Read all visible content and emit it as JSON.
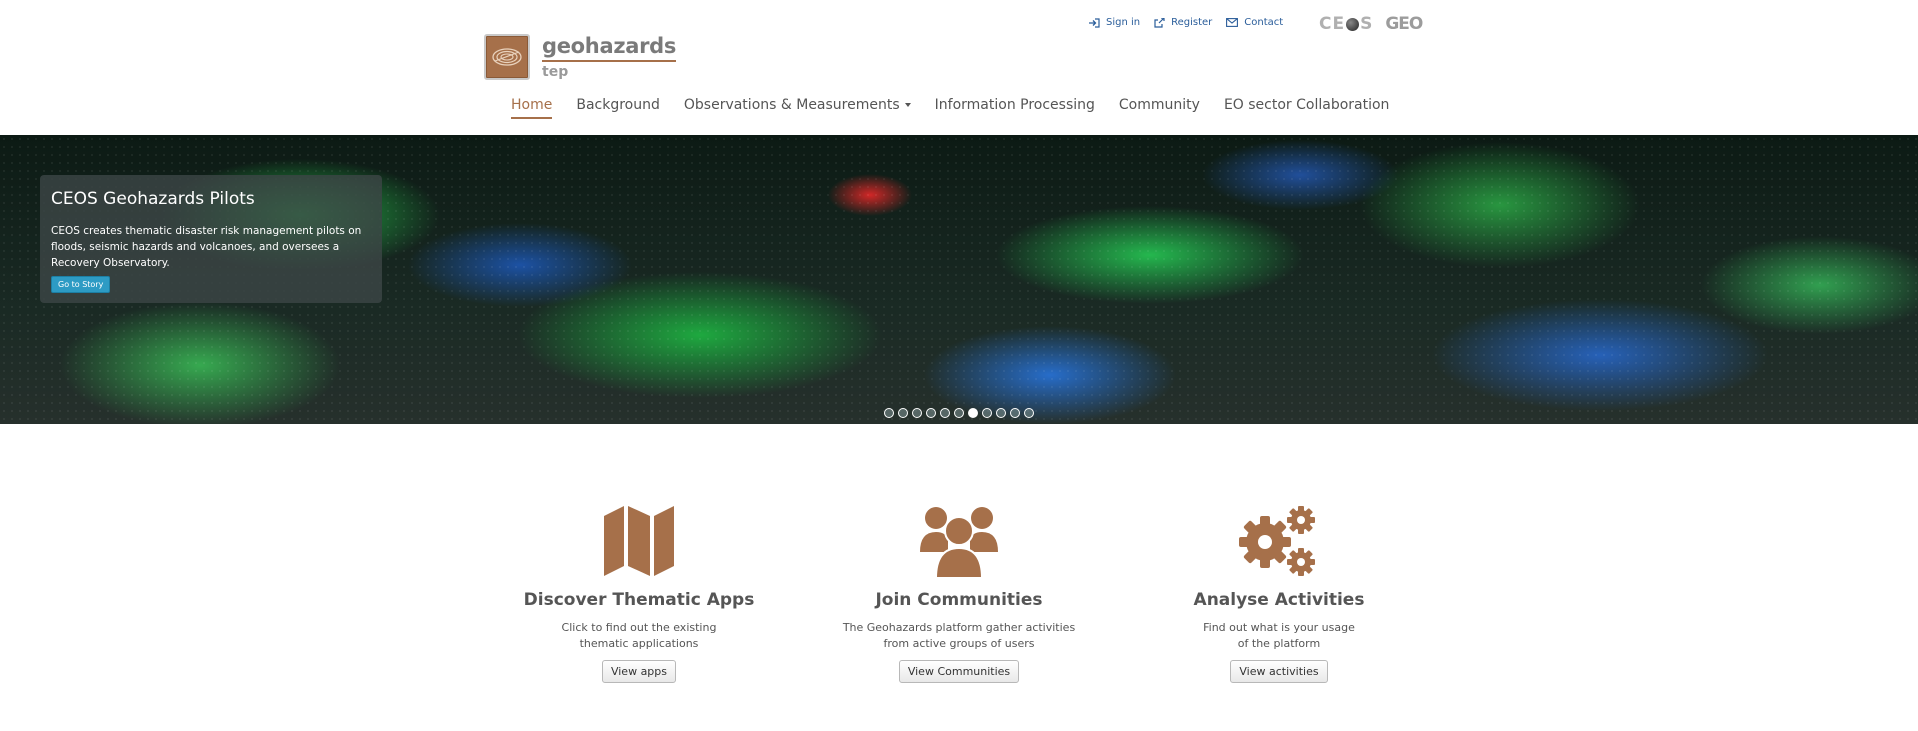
{
  "header": {
    "logo_main": "geohazards",
    "logo_sub": "tep",
    "top_links": [
      {
        "label": "Sign in",
        "icon": "sign-in-icon"
      },
      {
        "label": "Register",
        "icon": "external-link-icon"
      },
      {
        "label": "Contact",
        "icon": "envelope-icon"
      }
    ],
    "partner_logos": {
      "ceos": "CEOS",
      "geo": "GEO"
    }
  },
  "nav": {
    "items": [
      {
        "label": "Home",
        "active": true
      },
      {
        "label": "Background"
      },
      {
        "label": "Observations & Measurements",
        "dropdown": true
      },
      {
        "label": "Information Processing"
      },
      {
        "label": "Community"
      },
      {
        "label": "EO sector Collaboration"
      }
    ]
  },
  "hero": {
    "caption_title": "CEOS Geohazards Pilots",
    "caption_text": "CEOS creates thematic disaster risk management pilots on floods, seismic hazards and volcanoes, and oversees a Recovery Observatory.",
    "button_label": "Go to Story",
    "slide_count": 11,
    "active_slide": 7
  },
  "features": [
    {
      "title": "Discover Thematic Apps",
      "desc_line1": "Click to find out the existing",
      "desc_line2": "thematic applications",
      "button": "View apps",
      "icon": "map-icon"
    },
    {
      "title": "Join Communities",
      "desc_line1": "The Geohazards platform gather activities",
      "desc_line2": "from active groups of users",
      "button": "View Communities",
      "icon": "users-icon"
    },
    {
      "title": "Analyse Activities",
      "desc_line1": "Find out what is your usage",
      "desc_line2": "of the platform",
      "button": "View activities",
      "icon": "gears-icon"
    }
  ],
  "colors": {
    "accent": "#a6704a",
    "link": "#2a5d9a",
    "button_blue": "#2d9bc4"
  }
}
